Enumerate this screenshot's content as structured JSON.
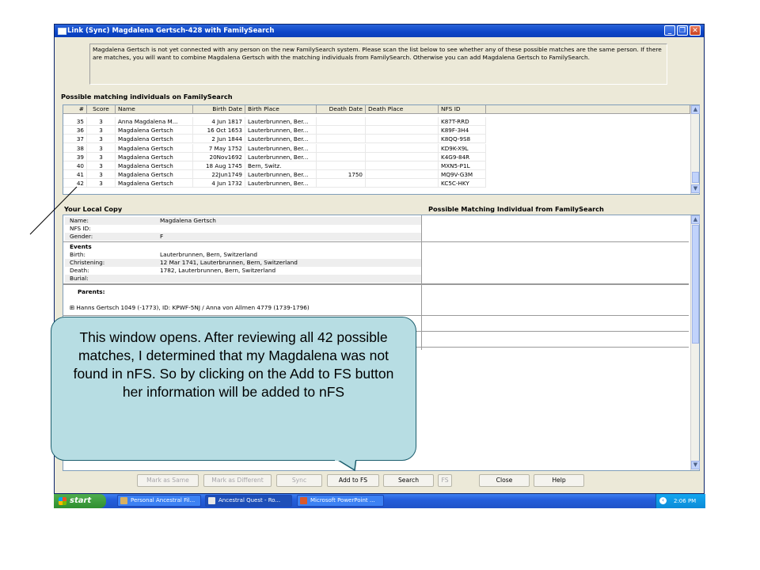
{
  "window": {
    "title": "Link (Sync) Magdalena Gertsch-428 with FamilySearch",
    "minimize": "_",
    "restore": "❐",
    "close": "✕"
  },
  "message": "Magdalena Gertsch is not yet connected with any person on the new FamilySearch system. Please scan the list below to see whether any of these possible matches are the same person. If there are matches, you will want to combine Magdalena Gertsch with the matching individuals from FamilySearch. Otherwise you can add Magdalena Gertsch to FamilySearch.",
  "matches": {
    "heading": "Possible matching individuals on FamilySearch",
    "columns": [
      "#",
      "Score",
      "Name",
      "Birth Date",
      "Birth Place",
      "Death Date",
      "Death Place",
      "NFS ID"
    ],
    "rows": [
      [
        "35",
        "3",
        "Anna Magdalena M...",
        "4 Jun 1817",
        "Lauterbrunnen, Ber...",
        "",
        "",
        "K87T-RRD"
      ],
      [
        "36",
        "3",
        "Magdalena Gertsch",
        "16 Oct 1653",
        "Lauterbrunnen, Ber...",
        "",
        "",
        "K89F-3H4"
      ],
      [
        "37",
        "3",
        "Magdalena Gertsch",
        "2 Jun 1844",
        "Lauterbrunnen, Ber...",
        "",
        "",
        "K8QQ-9S8"
      ],
      [
        "38",
        "3",
        "Magdalena Gertsch",
        "7 May 1752",
        "Lauterbrunnen, Ber...",
        "",
        "",
        "KD9K-X9L"
      ],
      [
        "39",
        "3",
        "Magdalena Gertsch",
        "20Nov1692",
        "Lauterbrunnen, Ber...",
        "",
        "",
        "K4G9-84R"
      ],
      [
        "40",
        "3",
        "Magdalena Gertsch",
        "18 Aug 1745",
        "Bern, Switz.",
        "",
        "",
        "MXN5-P1L"
      ],
      [
        "41",
        "3",
        "Magdalena Gertsch",
        "22Jun1749",
        "Lauterbrunnen, Ber...",
        "1750",
        "",
        "MQ9V-G3M"
      ],
      [
        "42",
        "3",
        "Magdalena Gertsch",
        "4 Jun 1732",
        "Lauterbrunnen, Ber...",
        "",
        "",
        "KC5C-HKY"
      ]
    ]
  },
  "local": {
    "heading": "Your Local Copy",
    "name_label": "Name:",
    "name_value": "Magdalena Gertsch",
    "nfsid_label": "NFS ID:",
    "nfsid_value": "",
    "gender_label": "Gender:",
    "gender_value": "F",
    "events_label": "Events",
    "birth_label": "Birth:",
    "birth_value": "Lauterbrunnen, Bern, Switzerland",
    "christening_label": "Christening:",
    "christening_value": "12 Mar 1741, Lauterbrunnen, Bern, Switzerland",
    "death_label": "Death:",
    "death_value": "1782, Lauterbrunnen, Bern, Switzerland",
    "burial_label": "Burial:",
    "burial_value": "",
    "parents_label": "Parents:",
    "parents_value": "⊞ Hanns Gertsch 1049 (-1773), ID: KPWF-5NJ / Anna von Allmen 4779 (1739-1796)"
  },
  "possible": {
    "heading": "Possible Matching Individual from FamilySearch"
  },
  "buttons": {
    "mark_same": "Mark as Same",
    "mark_different": "Mark as Different",
    "sync": "Sync",
    "add_to_fs": "Add to FS",
    "search": "Search",
    "fs": "FS",
    "close": "Close",
    "help": "Help"
  },
  "taskbar": {
    "start": "start",
    "task1": "Personal Ancestral Fil...",
    "task2": "Ancestral Quest - Ro...",
    "task3": "Microsoft PowerPoint ...",
    "clock": "2:06 PM"
  },
  "callout": "This window opens.  After reviewing all 42 possible matches, I determined that my Magdalena was not found in nFS.  So by clicking on the Add to FS button her information will be added to nFS",
  "colors": {
    "titlebar": "#0c45c8",
    "window_bg": "#ece9d8",
    "callout_bg": "#b7dde3",
    "callout_border": "#1c5e6e",
    "start_green": "#2f8f2f"
  }
}
